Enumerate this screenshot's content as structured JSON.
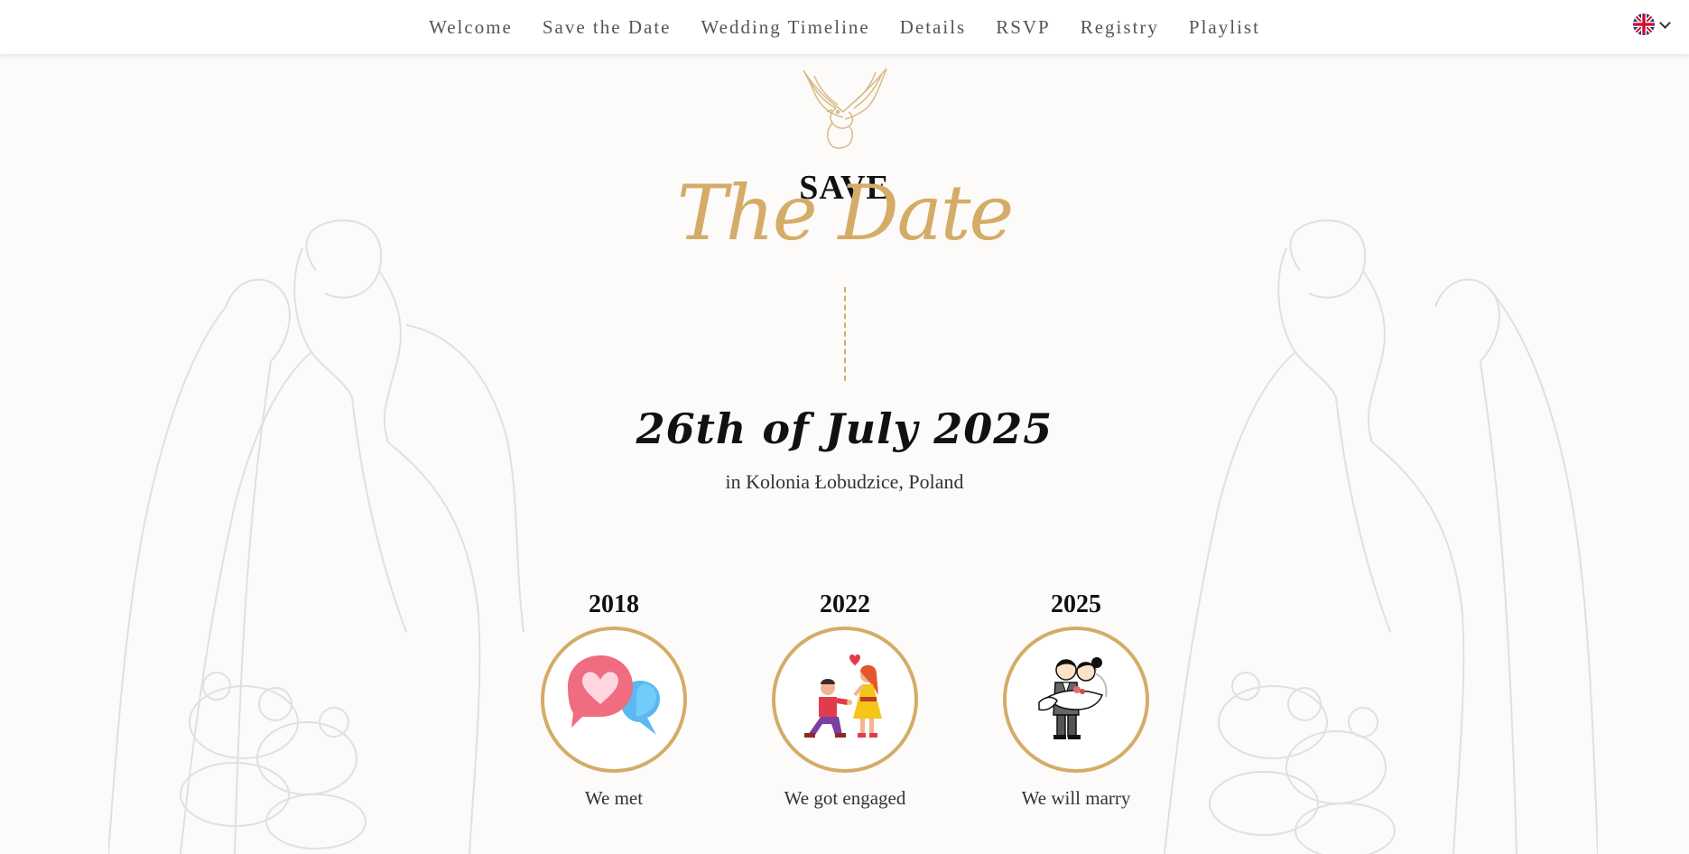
{
  "nav": {
    "links": [
      {
        "label": "Welcome"
      },
      {
        "label": "Save the Date"
      },
      {
        "label": "Wedding Timeline"
      },
      {
        "label": "Details"
      },
      {
        "label": "RSVP"
      },
      {
        "label": "Registry"
      },
      {
        "label": "Playlist"
      }
    ],
    "language_icon": "uk-flag-icon"
  },
  "hero": {
    "save": "SAVE",
    "the_date": "The Date",
    "date": "26th of July 2025",
    "location": "in Kolonia Łobudzice, Poland"
  },
  "milestones": [
    {
      "year": "2018",
      "label": "We met",
      "icon": "chat-hearts-icon"
    },
    {
      "year": "2022",
      "label": "We got engaged",
      "icon": "proposal-icon"
    },
    {
      "year": "2025",
      "label": "We will marry",
      "icon": "bride-groom-icon"
    }
  ],
  "colors": {
    "accent_gold": "#d4ac68",
    "background": "#fdfbf9",
    "text_dark": "#111111"
  }
}
